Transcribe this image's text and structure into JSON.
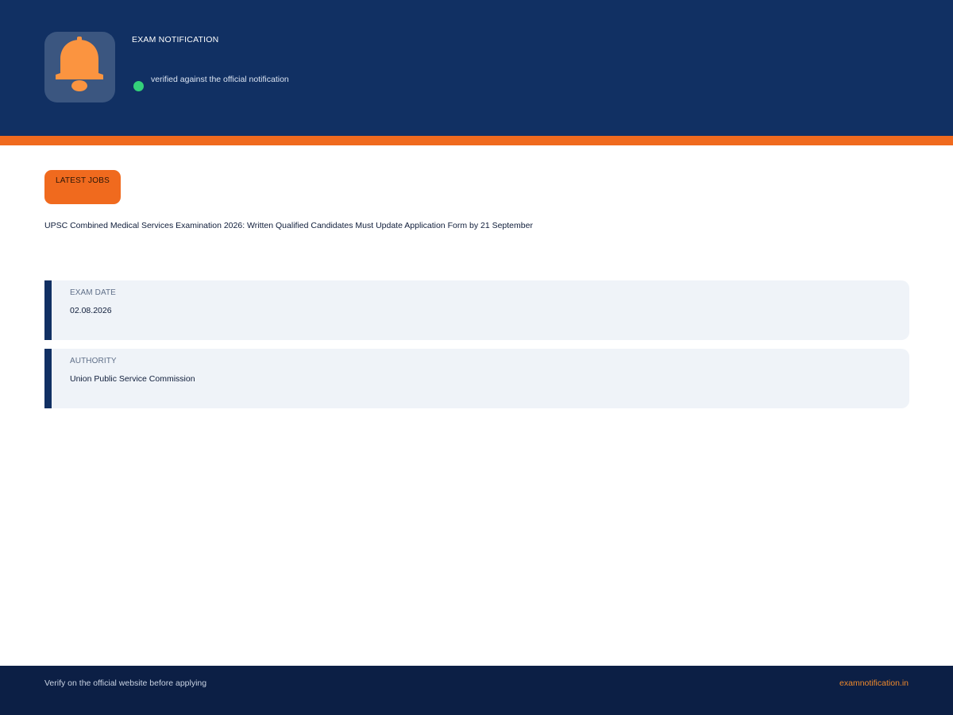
{
  "header": {
    "eyebrow": "EXAM NOTIFICATION",
    "logo_icon": "bell-icon",
    "verified_text": "verified against the official notification",
    "colors": {
      "background": "#113063",
      "stripe": "#f06a1e",
      "bell": "#fb9440",
      "verified_dot": "#34d17a"
    }
  },
  "main": {
    "category": "LATEST JOBS",
    "headline": "UPSC Combined Medical Services Examination 2026: Written Qualified Candidates Must Update Application Form by 21 September",
    "cards": [
      {
        "label": "EXAM DATE",
        "value": "02.08.2026"
      },
      {
        "label": "AUTHORITY",
        "value": "Union Public Service Commission"
      }
    ]
  },
  "footer": {
    "note": "Verify on the official website before applying",
    "site": "examnotification.in"
  }
}
